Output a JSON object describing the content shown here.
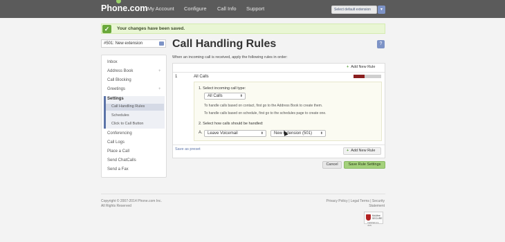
{
  "header": {
    "logo": "Phone.com",
    "nav": [
      "My Account",
      "Configure",
      "Call Info",
      "Support"
    ],
    "extension_selector": "Select default extension"
  },
  "banner": {
    "message": "Your changes have been saved."
  },
  "sidebar": {
    "extension_dropdown": "#501: New extension",
    "items": [
      "Inbox",
      "Address Book",
      "Call Blocking",
      "Greetings",
      "Settings",
      "Call Handling Rules",
      "Schedules",
      "Click to Call Button",
      "Conferencing",
      "Call Logs",
      "Place a Call",
      "Send ChatCalls",
      "Send a Fax"
    ]
  },
  "main": {
    "title": "Call Handling Rules",
    "intro": "When an incoming call is received, apply the following rules in order:",
    "add_new_rule": "Add New Rule",
    "rule": {
      "number": "1",
      "name": "All Calls",
      "step1_label": "1. Select incoming call type:",
      "step1_value": "All Calls",
      "hint1": "To handle calls based on contact, first go to the Address Book to create them.",
      "hint2": "To handle calls based on schedule, first go to the schedules page to create one.",
      "step2_label": "2. Select how calls should be handled:",
      "action_letter": "A.",
      "action_value": "Leave Voicemail",
      "target_value": "New extension (501)"
    },
    "save_as_preset": "Save as preset",
    "cancel": "Cancel",
    "save_settings": "Save Rule Settings"
  },
  "footer": {
    "copyright": "Copyright © 2007-2014 Phone.com Inc.",
    "rights": "All Rights Reserved",
    "links": "Privacy Policy | Legal Terms | Security Statement",
    "mcafee": "McAfee SECURE",
    "mcafee_date": "TESTED 21-JUN"
  },
  "colors": {
    "accent": "#7d93c6",
    "success": "#6aa83a",
    "save_button": "#a4d17b"
  }
}
